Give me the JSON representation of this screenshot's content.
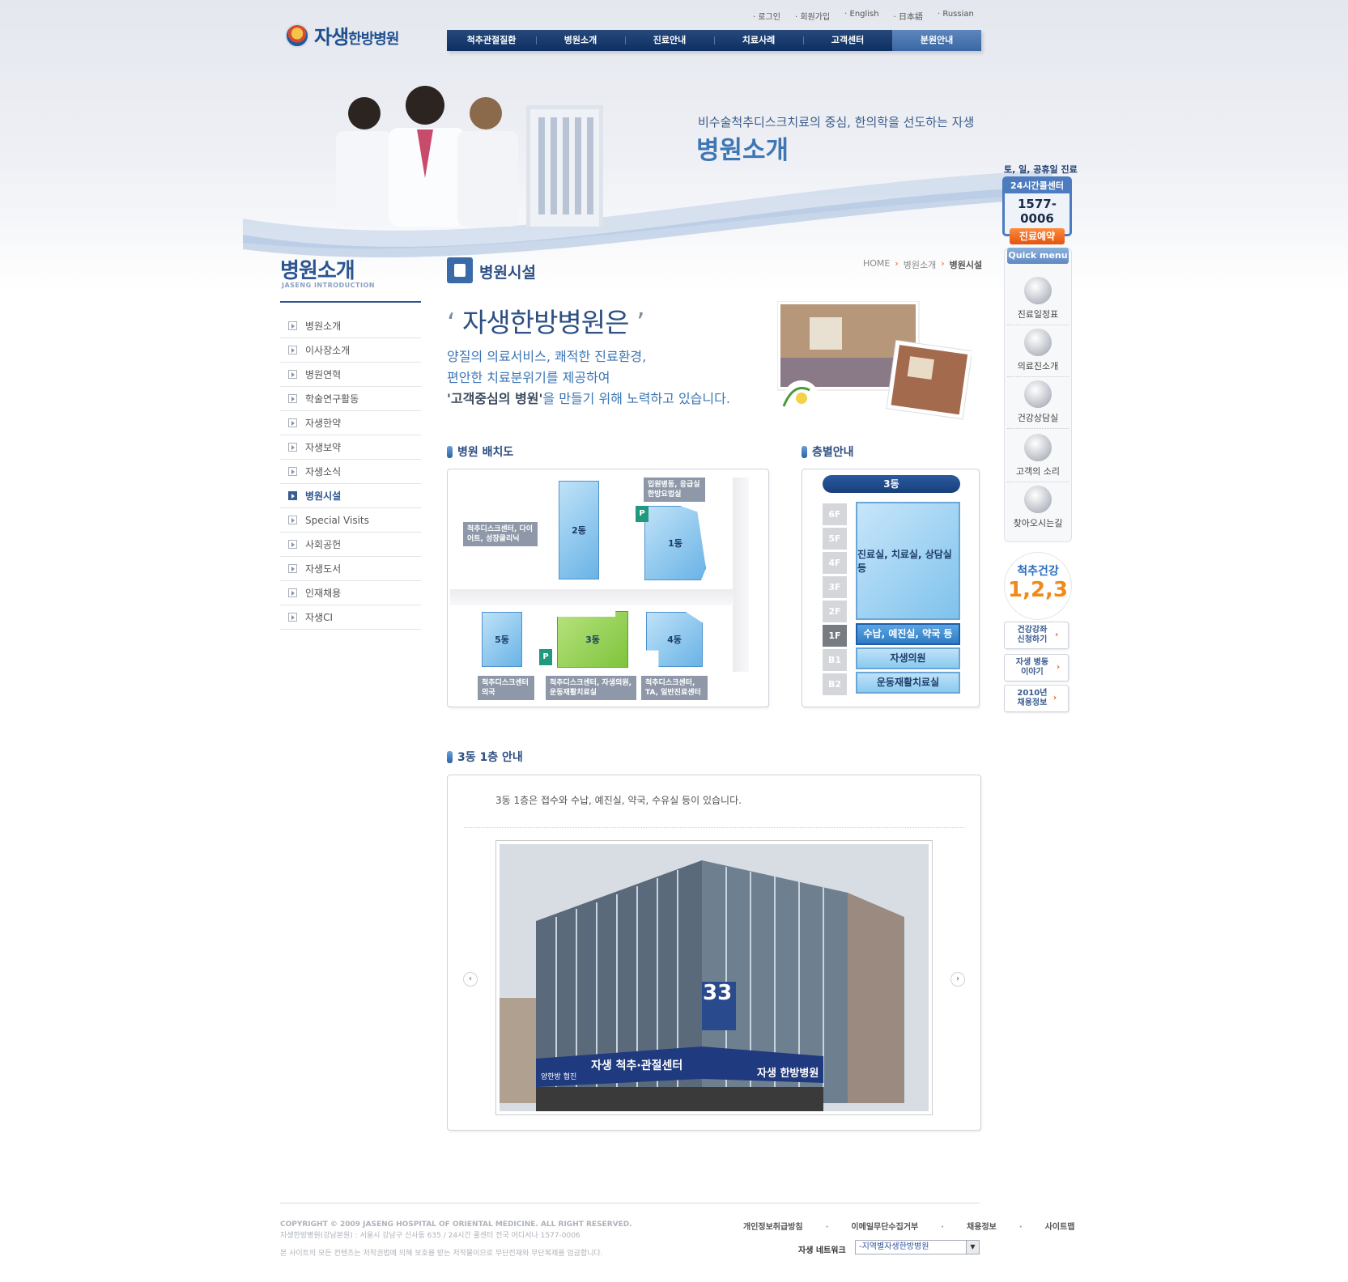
{
  "brand": {
    "logo_text": "자생",
    "logo_sub": "한방병원"
  },
  "util_links": [
    "로그인",
    "회원가입",
    "English",
    "日本語",
    "Russian"
  ],
  "gnb": [
    "척추관절질환",
    "병원소개",
    "진료안내",
    "치료사례",
    "고객센터",
    "분원안내"
  ],
  "visual": {
    "subtitle": "비수술척추디스크치료의 중심, 한의학을 선도하는 자생",
    "title": "병원소개"
  },
  "quick": {
    "head": "토, 일, 공휴일 진료",
    "call_title": "24시간콜센터",
    "call_number": "1577-0006",
    "reserve": "진료예약",
    "menu_title": "Quick menu",
    "items": [
      "진료일정표",
      "의료진소개",
      "건강상담실",
      "고객의 소리",
      "찾아오시는길"
    ],
    "spine_1": "척추건강",
    "spine_2": "1,2,3",
    "buttons": [
      "건강강좌 신청하기",
      "자생 병동이야기",
      "2010년 채용정보"
    ]
  },
  "lnb": {
    "title": "병원소개",
    "sub": "JASENG INTRODUCTION",
    "items": [
      "병원소개",
      "이사장소개",
      "병원연혁",
      "학술연구활동",
      "자생한약",
      "자생보약",
      "자생소식",
      "병원시설",
      "Special Visits",
      "사회공헌",
      "자생도서",
      "인재채용",
      "자생CI"
    ],
    "active": "병원시설"
  },
  "content": {
    "title": "병원시설",
    "breadcrumb": [
      "HOME",
      "병원소개",
      "병원시설"
    ],
    "intro_title": "자생한방병원은",
    "intro_l1": "양질의 의료서비스, 쾌적한 진료환경,",
    "intro_l2": "편안한 치료분위기를 제공하여",
    "intro_l3a": "'고객중심의 병원'",
    "intro_l3b": "을 만들기 위해 노력하고 있습니다."
  },
  "map": {
    "title": "병원 배치도",
    "buildings": [
      "2동",
      "1동",
      "5동",
      "3동",
      "4동"
    ],
    "tags": {
      "b2": "척추디스크센터, 다이어트, 성장클리닉",
      "b1": "입원병동, 응급실 한방요법실",
      "b5": "척추디스크센터 의국",
      "b3": "척추디스크센터, 자생의원, 운동재활치료실",
      "b4": "척추디스크센터, TA, 일반진료센터"
    },
    "parking": "P"
  },
  "floors": {
    "title": "층별안내",
    "building": "3동",
    "labels": [
      "6F",
      "5F",
      "4F",
      "3F",
      "2F",
      "1F",
      "B1",
      "B2"
    ],
    "upper": "진료실, 치료실, 상담실 등",
    "f1": "수납, 예진실, 약국 등",
    "b1": "자생의원",
    "b2": "운동재활치료실"
  },
  "guide": {
    "title": "3동 1층 안내",
    "text": "3동 1층은 접수와 수납, 예진실, 약국, 수유실 등이 있습니다.",
    "building_number": "33",
    "sign_1": "자생 척추·관절센터",
    "sign_2": "자생 한방병원",
    "sign_3": "양한방 협진"
  },
  "footer": {
    "copy": "COPYRIGHT © 2009 JASENG HOSPITAL OF ORIENTAL MEDICINE. ALL RIGHT RESERVED.",
    "address": "자생한방병원(강남본원) : 서울시 강남구 신사동 635  /  24시간 콜센터 전국 어디서나 1577-0006",
    "notice": "본 사이트의 모든 컨텐츠는 저작권법에 의해 보호를 받는 저작물이므로 무단전재와 무단복제를 엄금합니다.",
    "links": [
      "개인정보취급방침",
      "이메일무단수집거부",
      "채용정보",
      "사이트맵"
    ],
    "network_label": "자생 네트워크",
    "network_select": "-지역별자생한방병원"
  }
}
